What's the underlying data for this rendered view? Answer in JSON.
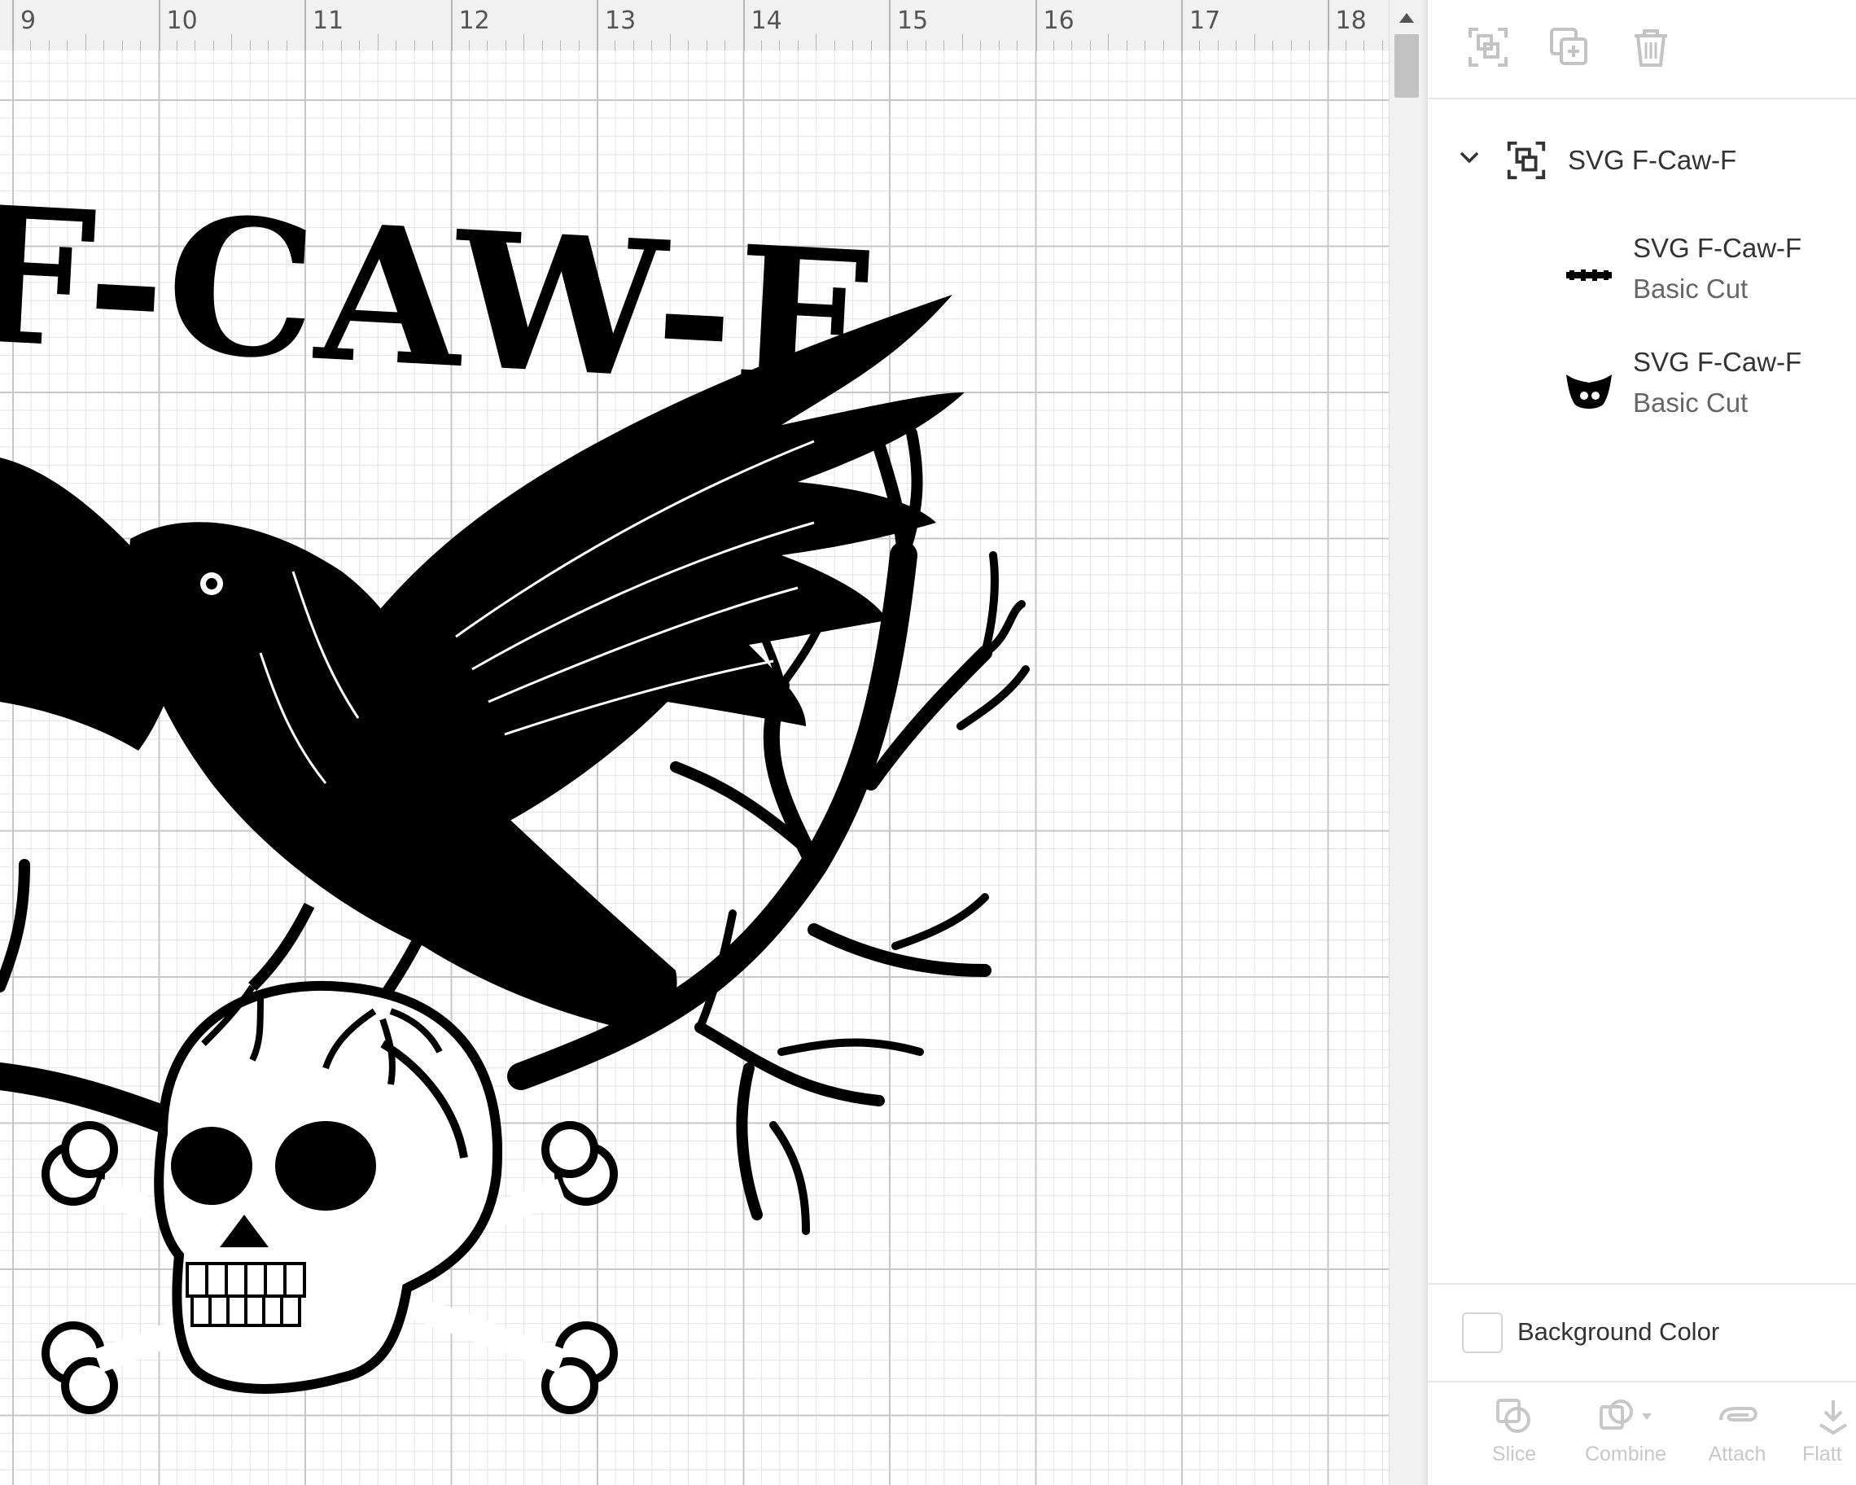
{
  "ruler": {
    "labels": [
      "9",
      "10",
      "11",
      "12",
      "13",
      "14",
      "15",
      "16",
      "17",
      "18"
    ]
  },
  "design": {
    "title_text": "F-CAW-F"
  },
  "panel": {
    "top_tools": [
      "group-icon",
      "duplicate-icon",
      "delete-icon"
    ],
    "group": {
      "label": "SVG F-Caw-F",
      "expanded": true
    },
    "layers": [
      {
        "name": "SVG F-Caw-F",
        "type": "Basic Cut",
        "thumbnail": "text-thumbnail"
      },
      {
        "name": "SVG F-Caw-F",
        "type": "Basic Cut",
        "thumbnail": "crow-thumbnail"
      }
    ],
    "background_label": "Background Color",
    "bottom_tools": [
      {
        "label": "Slice",
        "icon": "slice-icon"
      },
      {
        "label": "Combine",
        "icon": "combine-icon"
      },
      {
        "label": "Attach",
        "icon": "attach-icon"
      },
      {
        "label": "Flatt",
        "icon": "flatten-icon"
      }
    ]
  },
  "colors": {
    "design": "#000000",
    "disabled": "#c8c8c8",
    "text": "#333333"
  }
}
